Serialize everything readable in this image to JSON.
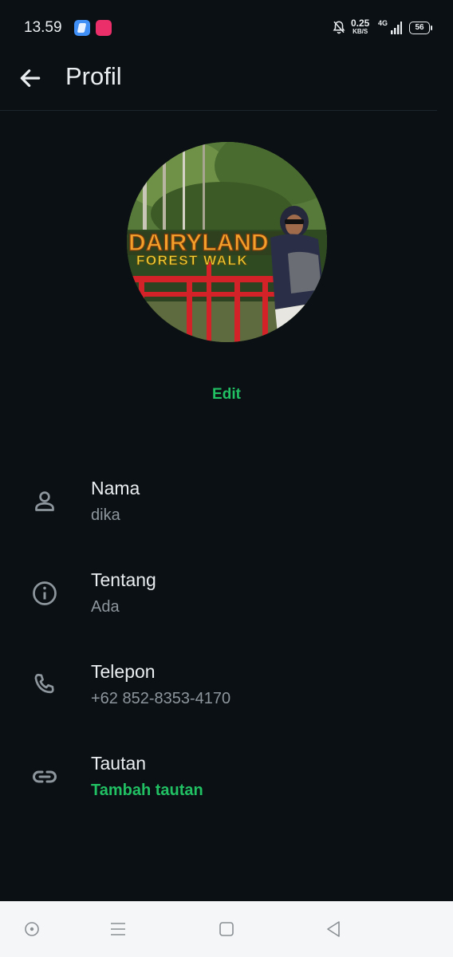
{
  "status_bar": {
    "time": "13.59",
    "speed_value": "0.25",
    "speed_unit": "KB/S",
    "network": "4G",
    "battery": "56"
  },
  "header": {
    "title": "Profil"
  },
  "profile": {
    "edit_label": "Edit",
    "photo_sign_line1": "DAIRYLAND",
    "photo_sign_line2": "FOREST WALK"
  },
  "fields": [
    {
      "label": "Nama",
      "value": "dika",
      "icon": "person-icon"
    },
    {
      "label": "Tentang",
      "value": "Ada",
      "icon": "info-icon"
    },
    {
      "label": "Telepon",
      "value": "+62 852-8353-4170",
      "icon": "phone-icon"
    },
    {
      "label": "Tautan",
      "value": "Tambah tautan",
      "icon": "link-icon"
    }
  ],
  "colors": {
    "background": "#0b1014",
    "accent": "#21c063",
    "text_primary": "#e9edef",
    "text_secondary": "#8d969c"
  }
}
